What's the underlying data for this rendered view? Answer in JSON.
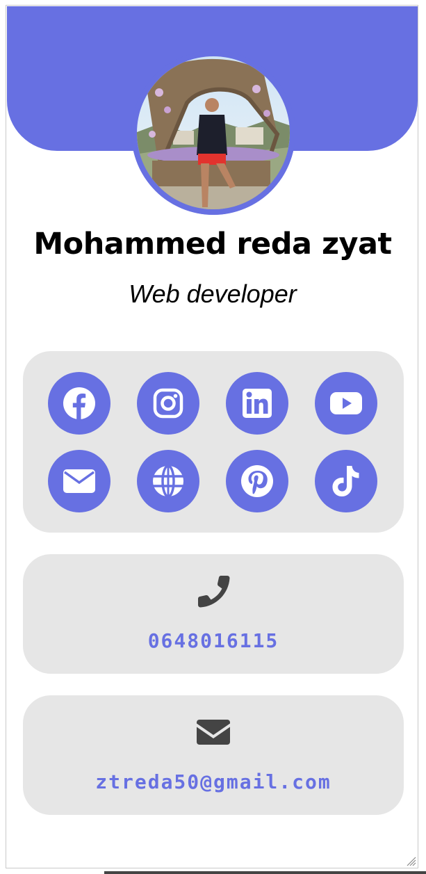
{
  "profile": {
    "name": "Mohammed reda zyat",
    "role": "Web developer",
    "avatar_alt": "profile-photo"
  },
  "social": {
    "items": [
      {
        "id": "facebook",
        "icon": "facebook-icon"
      },
      {
        "id": "instagram",
        "icon": "instagram-icon"
      },
      {
        "id": "linkedin",
        "icon": "linkedin-icon"
      },
      {
        "id": "youtube",
        "icon": "youtube-icon"
      },
      {
        "id": "email",
        "icon": "envelope-icon"
      },
      {
        "id": "website",
        "icon": "globe-icon"
      },
      {
        "id": "pinterest",
        "icon": "pinterest-icon"
      },
      {
        "id": "tiktok",
        "icon": "tiktok-icon"
      }
    ]
  },
  "contact": {
    "phone": "0648016115",
    "email": "ztreda50@gmail.com"
  },
  "colors": {
    "accent": "#6770e2",
    "panel": "#e6e6e6",
    "icon_dark": "#444444"
  }
}
